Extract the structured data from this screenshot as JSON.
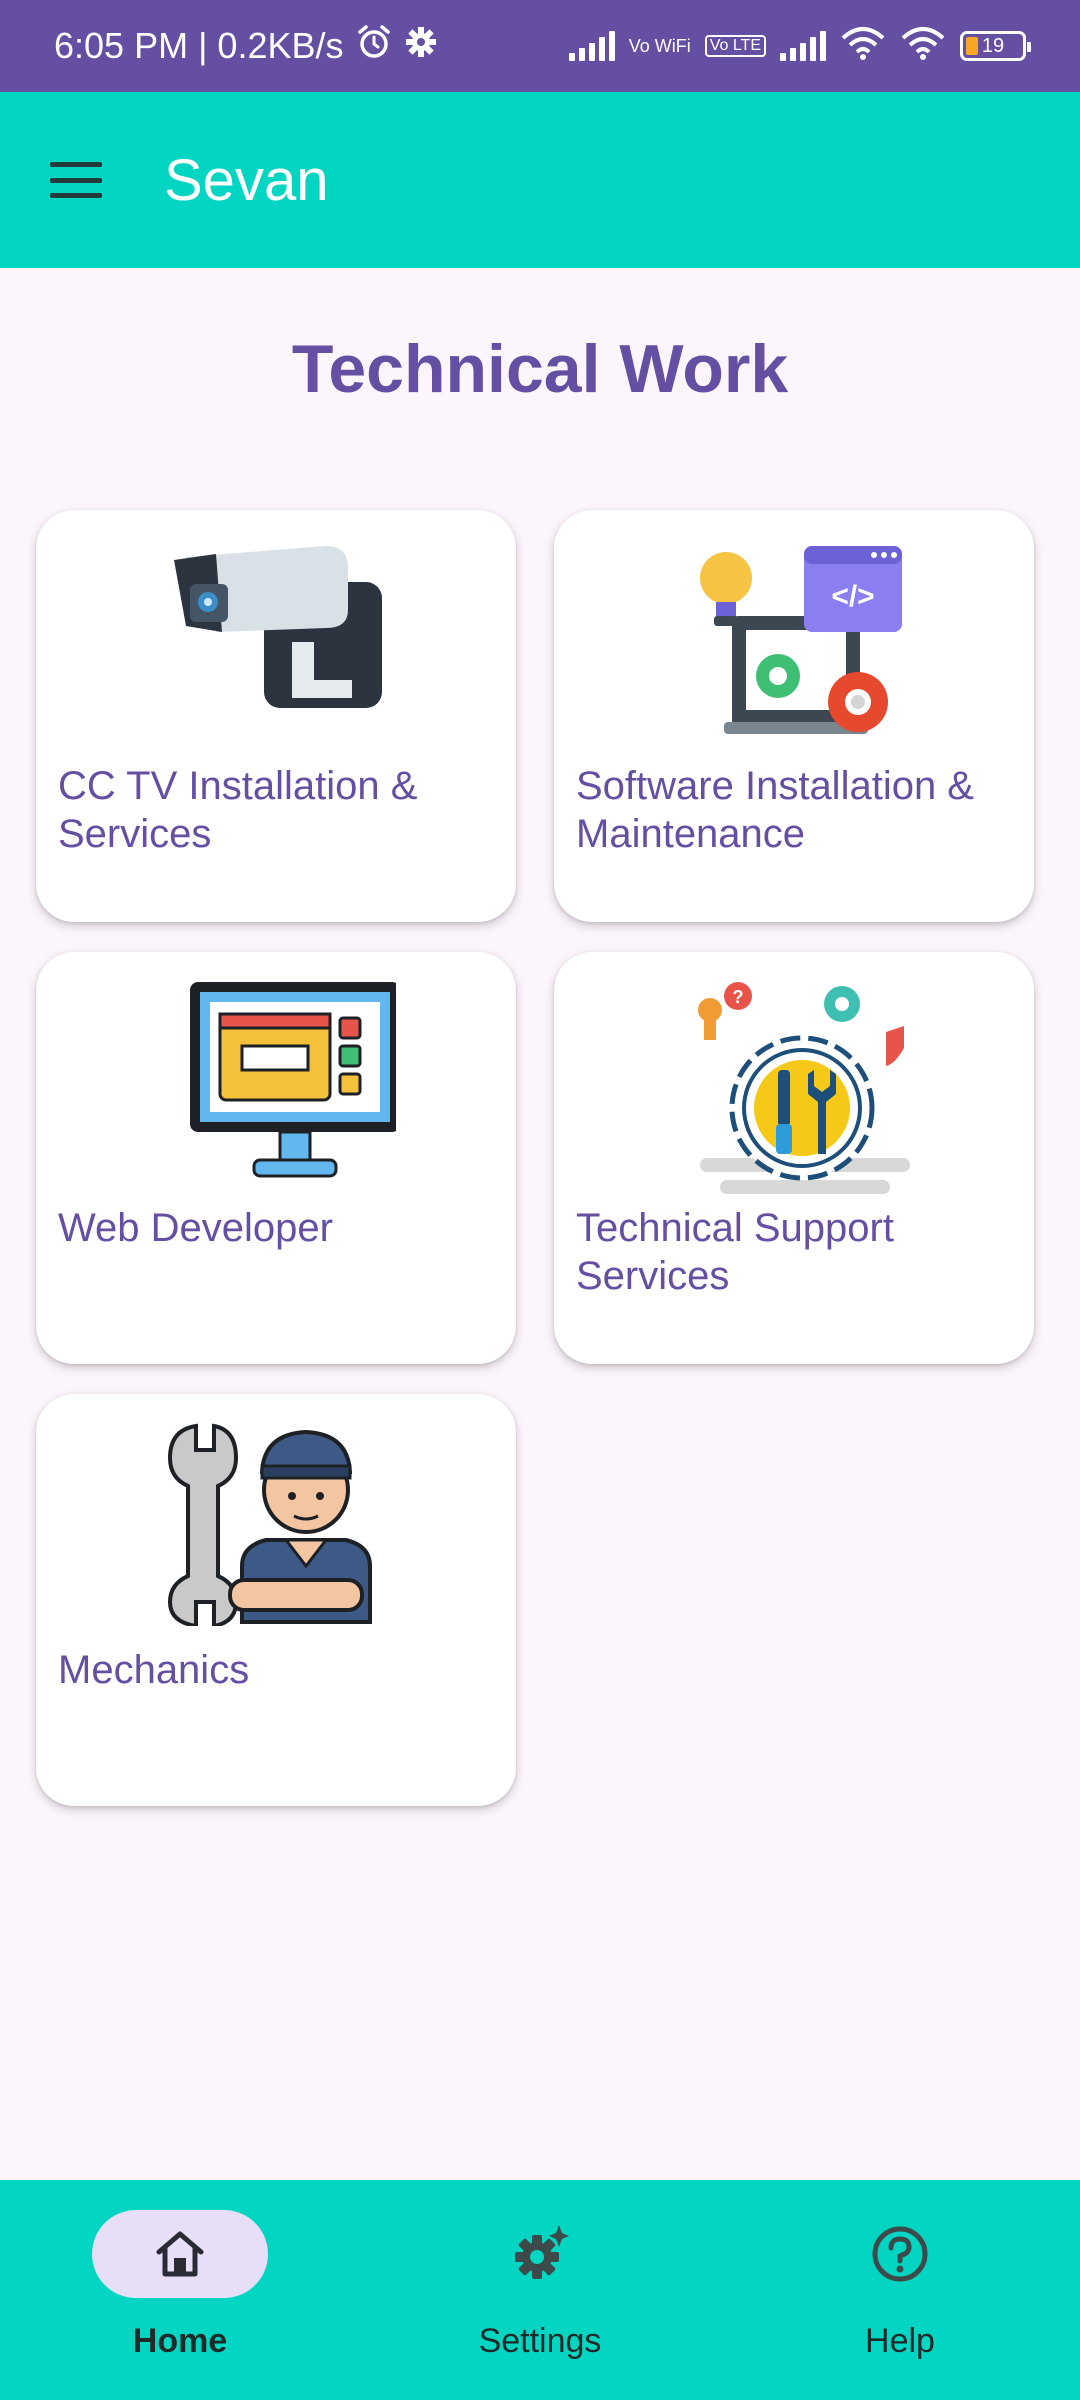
{
  "status_bar": {
    "time": "6:05 PM | 0.2KB/s",
    "vowifi": "Vo WiFi",
    "volte": "Vo LTE",
    "battery": "19"
  },
  "app_bar": {
    "title": "Sevan"
  },
  "page": {
    "title": "Technical Work"
  },
  "cards": [
    {
      "label": "CC TV Installation & Services",
      "icon": "cctv-camera-icon"
    },
    {
      "label": "Software Installation & Maintenance",
      "icon": "software-development-icon"
    },
    {
      "label": "Web Developer",
      "icon": "web-developer-monitor-icon"
    },
    {
      "label": "Technical Support Services",
      "icon": "technical-support-gear-icon"
    },
    {
      "label": "Mechanics",
      "icon": "mechanic-wrench-icon"
    }
  ],
  "bottom_nav": {
    "items": [
      {
        "label": "Home",
        "icon": "home-icon",
        "active": true
      },
      {
        "label": "Settings",
        "icon": "settings-gear-icon",
        "active": false
      },
      {
        "label": "Help",
        "icon": "help-circle-icon",
        "active": false
      }
    ]
  },
  "colors": {
    "status_bar": "#644fa3",
    "app_bar": "#02d6c2",
    "accent_text": "#644fa3",
    "background": "#fcf5fc",
    "active_pill": "#e6dff7"
  }
}
